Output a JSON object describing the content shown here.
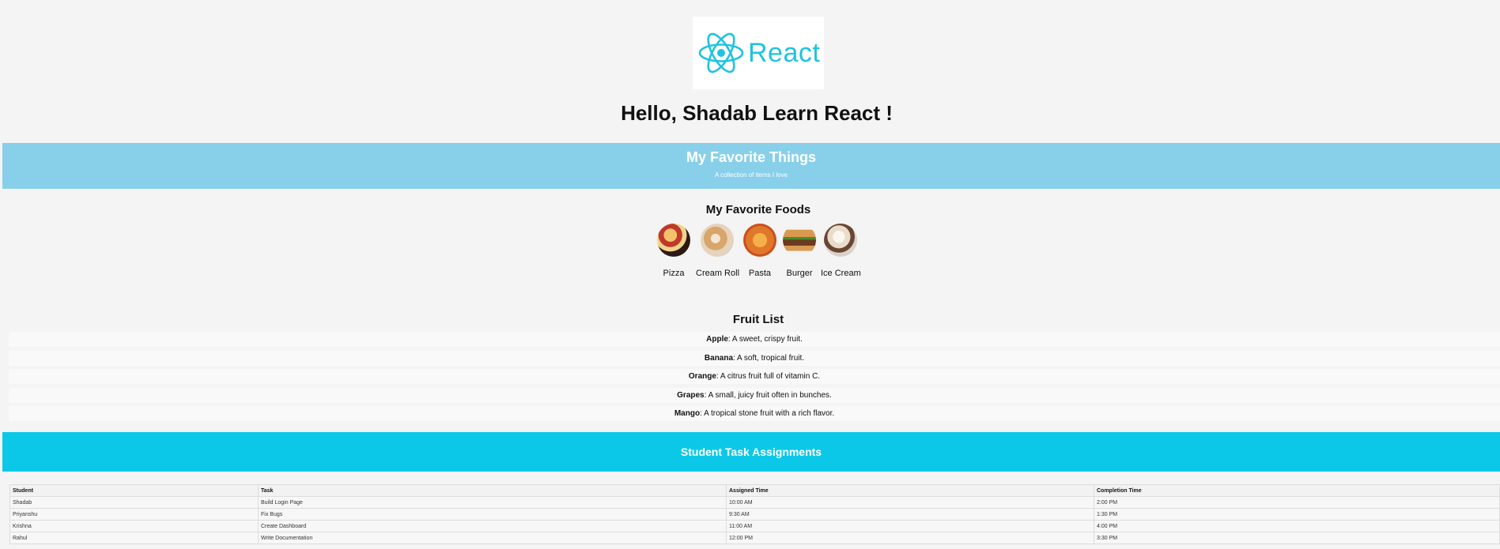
{
  "logo": {
    "text": "React",
    "color": "#1fc3e0"
  },
  "greeting": "Hello, Shadab Learn React !",
  "favorites_banner": {
    "title": "My Favorite Things",
    "subtitle": "A collection of items I love",
    "background": "#88cfea"
  },
  "foods": {
    "heading": "My Favorite Foods",
    "items": [
      {
        "label": "Pizza",
        "icon": "pizza-image"
      },
      {
        "label": "Cream Roll",
        "icon": "cream-roll-image"
      },
      {
        "label": "Pasta",
        "icon": "pasta-image"
      },
      {
        "label": "Burger",
        "icon": "burger-image"
      },
      {
        "label": "Ice Cream",
        "icon": "ice-cream-image"
      }
    ]
  },
  "fruits": {
    "heading": "Fruit List",
    "items": [
      {
        "name": "Apple",
        "description": ": A sweet, crispy fruit."
      },
      {
        "name": "Banana",
        "description": ": A soft, tropical fruit."
      },
      {
        "name": "Orange",
        "description": ": A citrus fruit full of vitamin C."
      },
      {
        "name": "Grapes",
        "description": ": A small, juicy fruit often in bunches."
      },
      {
        "name": "Mango",
        "description": ": A tropical stone fruit with a rich flavor."
      }
    ]
  },
  "tasks": {
    "title": "Student Task Assignments",
    "background": "#0cc8e8",
    "columns": [
      "Student",
      "Task",
      "Assigned Time",
      "Completion Time"
    ],
    "rows": [
      [
        "Shadab",
        "Build Login Page",
        "10:00 AM",
        "2:00 PM"
      ],
      [
        "Priyanshu",
        "Fix Bugs",
        "9:30 AM",
        "1:30 PM"
      ],
      [
        "Krishna",
        "Create Dashboard",
        "11:00 AM",
        "4:00 PM"
      ],
      [
        "Rahul",
        "Write Documentation",
        "12:00 PM",
        "3:30 PM"
      ]
    ]
  }
}
